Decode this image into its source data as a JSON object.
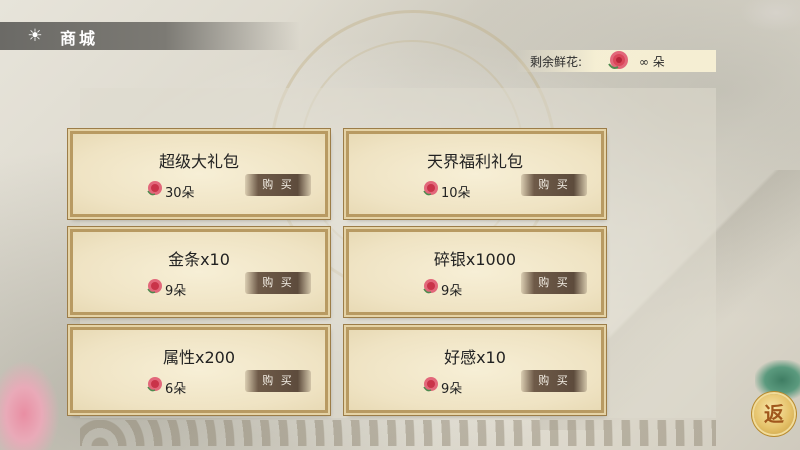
{
  "header": {
    "title": "商城",
    "icon": "sun-icon"
  },
  "flowers": {
    "label": "剩余鲜花:",
    "value": "∞ 朵",
    "icon": "flower-icon"
  },
  "items": [
    {
      "name": "超级大礼包",
      "price": "30朵",
      "buy_label": "购 买"
    },
    {
      "name": "天界福利礼包",
      "price": "10朵",
      "buy_label": "购 买"
    },
    {
      "name": "金条x10",
      "price": "9朵",
      "buy_label": "购 买"
    },
    {
      "name": "碎银x1000",
      "price": "9朵",
      "buy_label": "购 买"
    },
    {
      "name": "属性x200",
      "price": "6朵",
      "buy_label": "购 买"
    },
    {
      "name": "好感x10",
      "price": "9朵",
      "buy_label": "购 买"
    }
  ],
  "back_button": {
    "label": "返"
  },
  "colors": {
    "card_border": "#b89a62",
    "buy_bg": "#5d4b3c",
    "flower": "#d9475a",
    "header_bg": "#6b6a66"
  }
}
